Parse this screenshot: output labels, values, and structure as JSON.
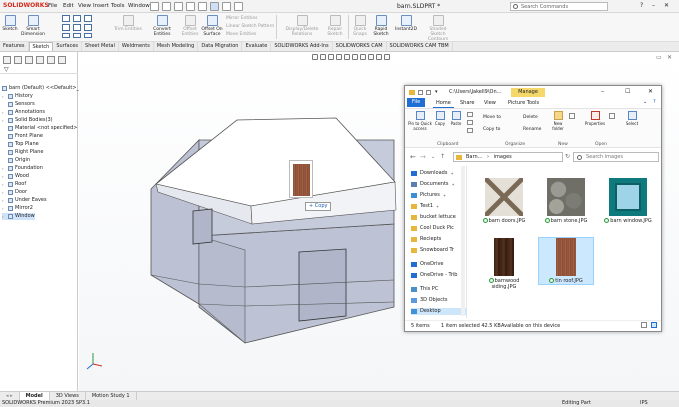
{
  "app": {
    "logo_text": "SOLIDWORKS",
    "menu": [
      "File",
      "Edit",
      "View",
      "Insert",
      "Tools",
      "Window"
    ],
    "document_title": "barn.SLDPRT *",
    "search_placeholder": "Search Commands"
  },
  "ribbon": {
    "buttons": [
      {
        "label": "Sketch",
        "enabled": true
      },
      {
        "label": "Smart Dimension",
        "enabled": true
      },
      {
        "label": "Trim Entities",
        "enabled": false
      },
      {
        "label": "Convert Entities",
        "enabled": true
      },
      {
        "label": "Offset Entities",
        "enabled": false
      },
      {
        "label": "Offset On Surface",
        "enabled": true
      },
      {
        "label": "Mirror Entities",
        "enabled": false
      },
      {
        "label": "Linear Sketch Pattern",
        "enabled": false
      },
      {
        "label": "Move Entities",
        "enabled": false
      },
      {
        "label": "Display/Delete Relations",
        "enabled": false
      },
      {
        "label": "Repair Sketch",
        "enabled": false
      },
      {
        "label": "Quick Snaps",
        "enabled": false
      },
      {
        "label": "Rapid Sketch",
        "enabled": true
      },
      {
        "label": "Instant2D",
        "enabled": true
      },
      {
        "label": "Shaded Sketch Contours",
        "enabled": false
      }
    ]
  },
  "tabs": [
    "Features",
    "Sketch",
    "Surfaces",
    "Sheet Metal",
    "Weldments",
    "Mesh Modeling",
    "Data Migration",
    "Evaluate",
    "SOLIDWORKS Add-Ins",
    "SOLIDWORKS CAM",
    "SOLIDWORKS CAM TBM"
  ],
  "active_tab": "Sketch",
  "tree": {
    "root": "barn (Default) <<Default>_D",
    "items": [
      {
        "label": "History",
        "arrow": "›"
      },
      {
        "label": "Sensors",
        "arrow": ""
      },
      {
        "label": "Annotations",
        "arrow": "›"
      },
      {
        "label": "Solid Bodies(3)",
        "arrow": "›"
      },
      {
        "label": "Material <not specified>",
        "arrow": ""
      },
      {
        "label": "Front Plane",
        "arrow": ""
      },
      {
        "label": "Top Plane",
        "arrow": ""
      },
      {
        "label": "Right Plane",
        "arrow": ""
      },
      {
        "label": "Origin",
        "arrow": ""
      },
      {
        "label": "Foundation",
        "arrow": "›"
      },
      {
        "label": "Wood",
        "arrow": "›"
      },
      {
        "label": "Roof",
        "arrow": "›"
      },
      {
        "label": "Door",
        "arrow": "›"
      },
      {
        "label": "Under Eaves",
        "arrow": "›"
      },
      {
        "label": "Mirror2",
        "arrow": "›"
      },
      {
        "label": "Window",
        "arrow": "›"
      }
    ],
    "selected": "Window"
  },
  "drag": {
    "label": "+ Copy"
  },
  "explorer": {
    "manage_tab": "Manage",
    "path_title": "C:\\Users\\Jakell9\\On...",
    "ribbon_tabs": [
      "File",
      "Home",
      "Share",
      "View",
      "Picture Tools"
    ],
    "home_buttons": [
      {
        "label": "Pin to Quick access"
      },
      {
        "label": "Copy"
      },
      {
        "label": "Paste"
      },
      {
        "label": "Move to"
      },
      {
        "label": "Copy to"
      },
      {
        "label": "Delete"
      },
      {
        "label": "Rename"
      },
      {
        "label": "New folder"
      },
      {
        "label": "Properties"
      },
      {
        "label": "Select"
      }
    ],
    "groups": [
      "Clipboard",
      "Organize",
      "New",
      "Open"
    ],
    "breadcrumb": [
      "Barn...",
      "images"
    ],
    "search_placeholder": "Search images",
    "nav": [
      {
        "label": "Downloads",
        "pin": true,
        "kind": "download"
      },
      {
        "label": "Documents",
        "pin": true,
        "kind": "doc"
      },
      {
        "label": "Pictures",
        "pin": true,
        "kind": "pic"
      },
      {
        "label": "Test1",
        "pin": true,
        "kind": "folder"
      },
      {
        "label": "bucket lettuce",
        "pin": false,
        "kind": "folder"
      },
      {
        "label": "Cool Duck Pic",
        "pin": false,
        "kind": "folder"
      },
      {
        "label": "Reciepts",
        "pin": false,
        "kind": "folder"
      },
      {
        "label": "Snowboard Tr",
        "pin": false,
        "kind": "folder"
      },
      {
        "label": "OneDrive",
        "pin": false,
        "kind": "cloud"
      },
      {
        "label": "OneDrive - Trib",
        "pin": false,
        "kind": "cloud"
      },
      {
        "label": "This PC",
        "pin": false,
        "kind": "pc"
      },
      {
        "label": "3D Objects",
        "pin": false,
        "kind": "obj"
      },
      {
        "label": "Desktop",
        "pin": false,
        "kind": "desk"
      }
    ],
    "selected_nav": "Desktop",
    "files": [
      {
        "name": "barn doors.JPG",
        "kind": "doors"
      },
      {
        "name": "barn stone.JPG",
        "kind": "stone"
      },
      {
        "name": "barn window.JPG",
        "kind": "window"
      },
      {
        "name": "barnwood siding.JPG",
        "kind": "siding"
      },
      {
        "name": "tin roof.JPG",
        "kind": "tin"
      }
    ],
    "selected_file": "tin roof.JPG",
    "status": {
      "count": "5 items",
      "selection": "1 item selected  42.5 KB",
      "availability": "Available on this device"
    }
  },
  "bottom_tabs": [
    "Model",
    "3D Views",
    "Motion Study 1"
  ],
  "active_bottom_tab": "Model",
  "statusbar": {
    "left": "SOLIDWORKS Premium 2023 SP3.1",
    "mid": "Editing Part",
    "right": "IPS"
  },
  "colors": {
    "accent": "#1f6ed4",
    "manage": "#f4d86a",
    "logo": "#d52b1e",
    "selection": "#cce8ff"
  }
}
